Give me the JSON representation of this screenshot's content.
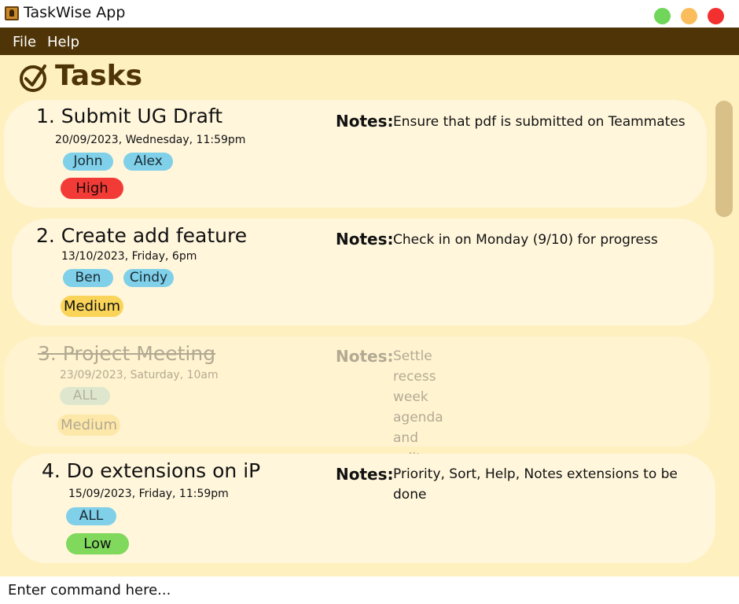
{
  "window": {
    "title": "TaskWise App",
    "app_icon": "app-icon",
    "controls": [
      "maximize",
      "minimize",
      "close"
    ]
  },
  "menu": {
    "file": "File",
    "help": "Help"
  },
  "main": {
    "title": "Tasks",
    "title_icon": "check-circle-icon"
  },
  "notes_label": "Notes:",
  "tasks": [
    {
      "title": "1. Submit UG Draft",
      "date": "20/09/2023, Wednesday, 11:59pm",
      "tags": [
        "John",
        "Alex"
      ],
      "priority": "High",
      "notes": "Ensure that pdf is submitted on Teammates",
      "done": false
    },
    {
      "title": "2. Create add feature",
      "date": "13/10/2023, Friday, 6pm",
      "tags": [
        "Ben",
        "Cindy"
      ],
      "priority": "Medium",
      "notes": "Check in on Monday (9/10) for progress",
      "done": false
    },
    {
      "title": "3. Project Meeting",
      "date": "23/09/2023, Saturday, 10am",
      "tags": [
        "ALL"
      ],
      "priority": "Medium",
      "notes": "Settle recess week agenda and split work",
      "done": true
    },
    {
      "title": "4. Do extensions on iP",
      "date": "15/09/2023, Friday, 11:59pm",
      "tags": [
        "ALL"
      ],
      "priority": "Low",
      "notes_line1": "Priority, Sort, Help, Notes extensions to be",
      "notes_line2": "done",
      "done": false
    }
  ],
  "colors": {
    "menubar": "#4e3406",
    "background": "#fff0c0",
    "card": "#fff6dc",
    "tag": "#7fd0e8",
    "priority_high": "#f23b37",
    "priority_medium": "#fad458",
    "priority_low": "#80d85c"
  },
  "command": {
    "placeholder": "Enter command here..."
  }
}
